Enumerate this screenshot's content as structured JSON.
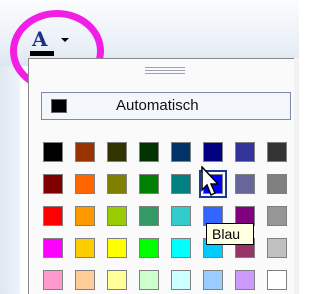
{
  "toolbar": {
    "font_color_letter": "A",
    "font_color_icon": "font-color-icon",
    "dropdown_icon": "chevron-down-icon"
  },
  "palette": {
    "automatic_label": "Automatisch",
    "automatic_color": "#000000",
    "rows": [
      [
        "#000000",
        "#993300",
        "#333300",
        "#003300",
        "#003366",
        "#000080",
        "#333399",
        "#333333"
      ],
      [
        "#800000",
        "#FF6600",
        "#808000",
        "#008000",
        "#008080",
        "#0000FF",
        "#666699",
        "#808080"
      ],
      [
        "#FF0000",
        "#FF9900",
        "#99CC00",
        "#339966",
        "#33CCCC",
        "#3366FF",
        "#800080",
        "#969696"
      ],
      [
        "#FF00FF",
        "#FFCC00",
        "#FFFF00",
        "#00FF00",
        "#00FFFF",
        "#00CCFF",
        "#993366",
        "#C0C0C0"
      ],
      [
        "#FF99CC",
        "#FFCC99",
        "#FFFF99",
        "#CCFFCC",
        "#CCFFFF",
        "#99CCFF",
        "#CC99FF",
        "#FFFFFF"
      ]
    ],
    "selected": {
      "row": 1,
      "col": 5
    }
  },
  "tooltip": {
    "text": "Blau"
  },
  "colors": {
    "highlight_circle": "#F21EE6"
  }
}
